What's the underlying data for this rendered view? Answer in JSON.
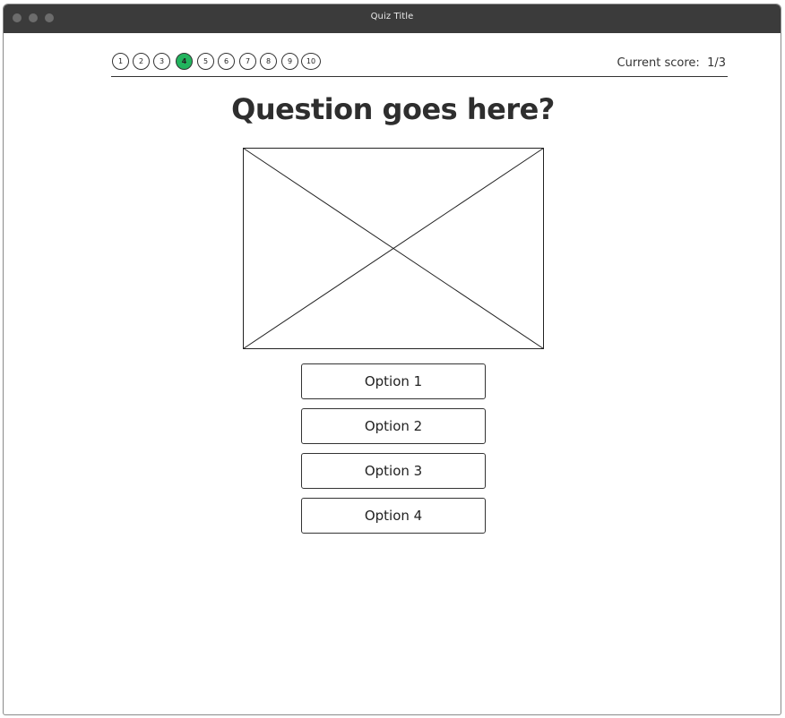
{
  "window": {
    "title": "Quiz Title"
  },
  "progress": {
    "steps": [
      "1",
      "2",
      "3",
      "4",
      "5",
      "6",
      "7",
      "8",
      "9",
      "10"
    ],
    "current_step": 4,
    "active_color": "#22b45e"
  },
  "score": {
    "text": "Current score:  1/3"
  },
  "question": {
    "text": "Question goes here?"
  },
  "options": [
    {
      "label": "Option 1"
    },
    {
      "label": "Option 2"
    },
    {
      "label": "Option 3"
    },
    {
      "label": "Option 4"
    }
  ]
}
